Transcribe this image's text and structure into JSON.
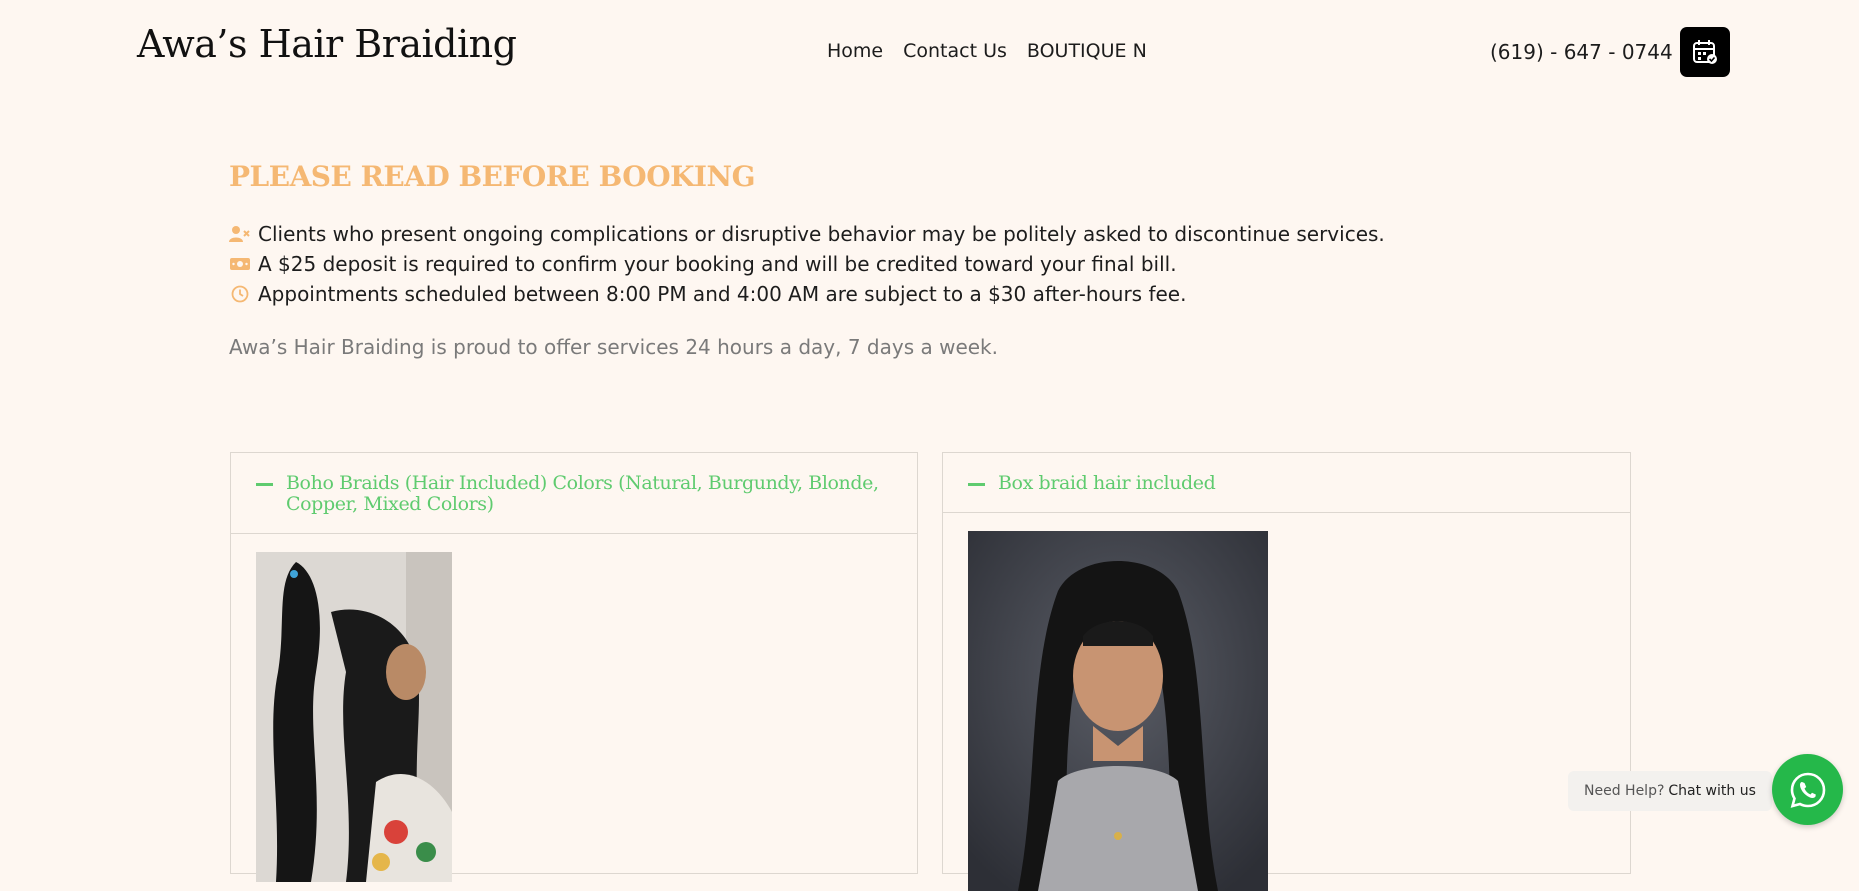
{
  "header": {
    "brand": "Awa’s Hair Braiding",
    "nav": [
      {
        "label": "Home"
      },
      {
        "label": "Contact Us"
      },
      {
        "label": "BOUTIQUE N"
      }
    ],
    "phone": "(619) - 647 - 0744",
    "book_icon": "calendar-check-icon"
  },
  "notice": {
    "title": "PLEASE READ BEFORE BOOKING",
    "rules": [
      {
        "icon": "user-x-icon",
        "text": "Clients who present ongoing complications or disruptive behavior may be politely asked to discontinue services."
      },
      {
        "icon": "money-icon",
        "text": "A $25 deposit is required to confirm your booking and will be credited toward your final bill."
      },
      {
        "icon": "clock-icon",
        "text": "Appointments scheduled between 8:00 PM and 4:00 AM are subject to a $30 after-hours fee."
      }
    ],
    "note": "Awa’s Hair Braiding is proud to offer services 24 hours a day, 7 days a week."
  },
  "services": [
    {
      "title_line1": "Boho Braids (Hair Included) Colors (Natural, Burgundy, Blonde,",
      "title_line2": "Copper, Mixed Colors)"
    },
    {
      "title_line1": "Box braid hair included",
      "title_line2": ""
    }
  ],
  "chat": {
    "prefix": "Need Help?",
    "action": "Chat with us",
    "icon": "whatsapp-icon"
  },
  "colors": {
    "accent": "#f5b873",
    "green": "#5fcb6f",
    "background": "#fef7f1"
  }
}
